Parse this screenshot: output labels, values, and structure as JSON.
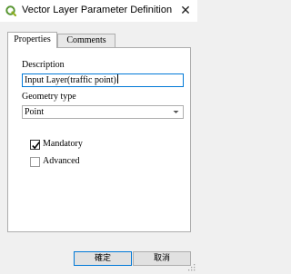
{
  "window": {
    "title": "Vector Layer Parameter Definition",
    "close_glyph": "✕",
    "app_icon": "qgis-icon",
    "accent_color": "#0078d7"
  },
  "tabs": [
    {
      "label": "Properties",
      "active": true
    },
    {
      "label": "Comments",
      "active": false
    }
  ],
  "form": {
    "description_label": "Description",
    "description_value": "Input Layer(traffic point)",
    "geometry_label": "Geometry type",
    "geometry_value": "Point",
    "mandatory_label": "Mandatory",
    "mandatory_checked": true,
    "advanced_label": "Advanced",
    "advanced_checked": false
  },
  "buttons": {
    "ok_label": "確定",
    "cancel_label": "取消"
  }
}
